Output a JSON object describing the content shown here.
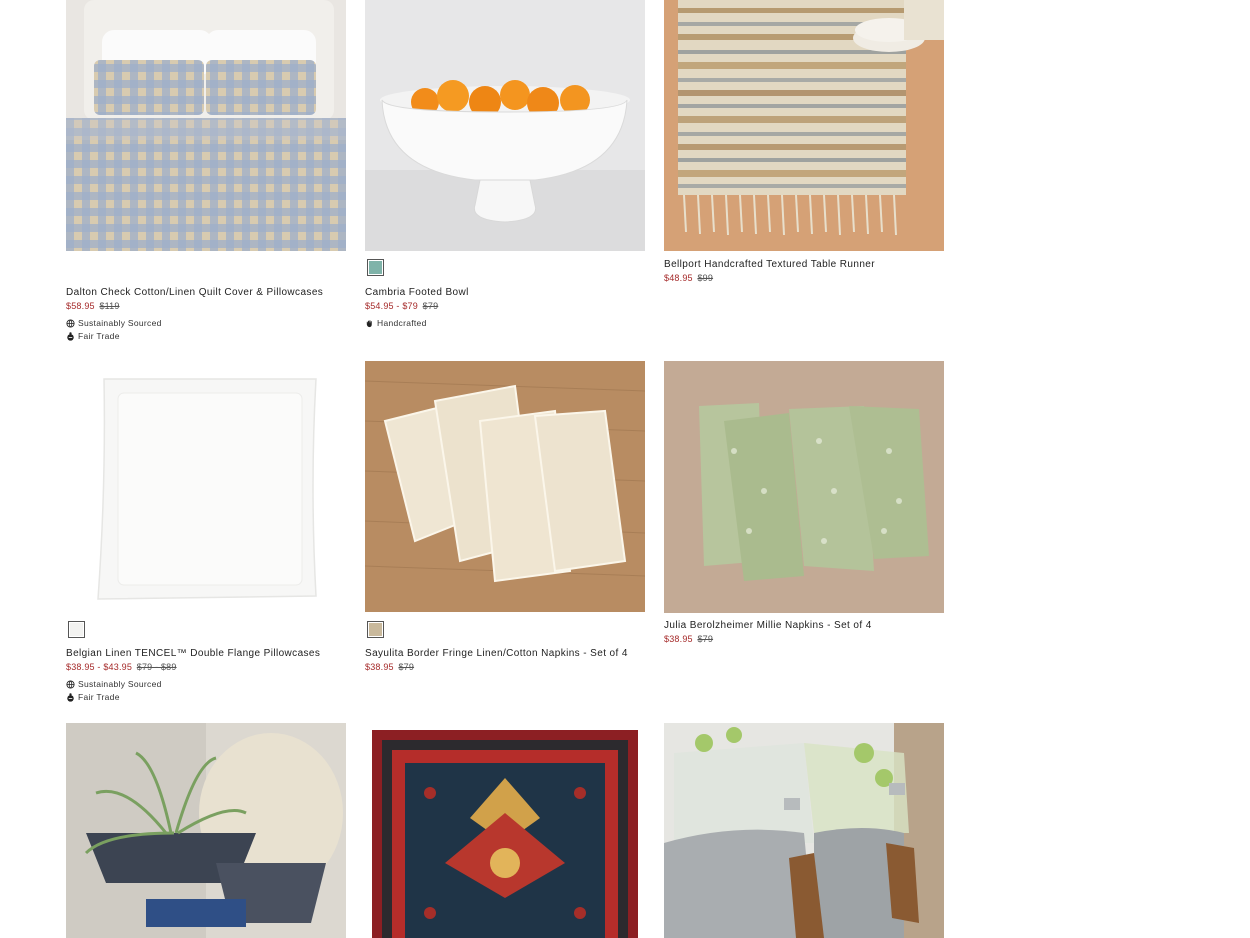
{
  "products": [
    {
      "name": "Dalton Check Cotton/Linen Quilt Cover & Pillowcases",
      "price_sale": "$58.95",
      "price_orig": "$119",
      "badges": [
        "Sustainably Sourced",
        "Fair Trade"
      ],
      "badge_icons": [
        "globe-icon",
        "fair-trade-icon"
      ],
      "image": "image-blue-gingham-bedding"
    },
    {
      "name": "Cambria Footed Bowl",
      "price_sale": "$54.95 - $79",
      "price_orig": "$79",
      "swatch_color": "#7fb3a9",
      "badges": [
        "Handcrafted"
      ],
      "badge_icons": [
        "hand-icon"
      ],
      "image": "image-white-footed-bowl-oranges"
    },
    {
      "name": "Bellport Handcrafted Textured Table Runner",
      "price_sale": "$48.95",
      "price_orig": "$99",
      "image": "image-striped-table-runner"
    },
    {
      "name": "Belgian Linen TENCEL™ Double Flange Pillowcases",
      "price_sale": "$38.95 - $43.95",
      "price_orig": "$79 - $89",
      "swatch_color": "#f2f2f0",
      "badges": [
        "Sustainably Sourced",
        "Fair Trade"
      ],
      "badge_icons": [
        "globe-icon",
        "fair-trade-icon"
      ],
      "image": "image-white-pillowcase"
    },
    {
      "name": "Sayulita Border Fringe Linen/Cotton Napkins - Set of 4",
      "price_sale": "$38.95",
      "price_orig": "$79",
      "swatch_color": "#c9b99c",
      "image": "image-cream-fringe-napkins"
    },
    {
      "name": "Julia Berolzheimer Millie Napkins - Set of 4",
      "price_sale": "$38.95",
      "price_orig": "$79",
      "image": "image-green-floral-napkins"
    },
    {
      "image": "image-air-plant-bowls"
    },
    {
      "image": "image-red-persian-rug"
    },
    {
      "image": "image-galvanized-drink-dispensers"
    }
  ],
  "colors": {
    "sale_price": "#a52a2a",
    "text": "#222222"
  }
}
